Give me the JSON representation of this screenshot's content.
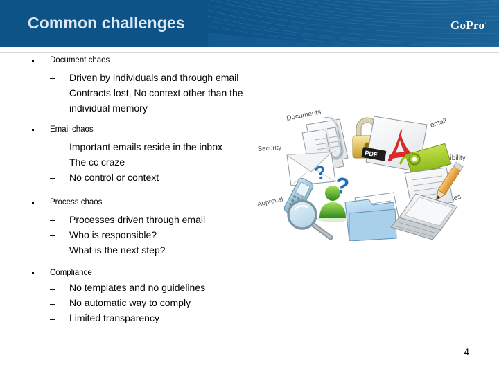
{
  "header": {
    "title": "Common challenges",
    "logo_text": "GoPro",
    "logo_mark": "·",
    "background_color": "#0e5387",
    "title_color": "#dce8f4"
  },
  "content": {
    "blocks": [
      {
        "heading": "Document chaos",
        "items": [
          "Driven by individuals and through email",
          "Contracts lost, No context other than the",
          "individual memory"
        ]
      },
      {
        "heading": "Email chaos",
        "items": [
          "Important emails reside in the inbox",
          "The cc craze",
          "No control or context"
        ]
      },
      {
        "heading": "Process chaos",
        "items": [
          "Processes driven through email",
          "Who is responsible?",
          "What is the next step?"
        ]
      },
      {
        "heading": "Compliance",
        "items": [
          "No templates and no guidelines",
          "No automatic way to comply",
          "Limited transparency"
        ]
      }
    ],
    "bullet_dash": "–"
  },
  "collage": {
    "labels": {
      "documents": "Documents",
      "security": "Security",
      "approval": "Approval",
      "email": "email",
      "responsibility": "Responsibility",
      "phases": "Phases"
    },
    "pdf_badge": "PDF",
    "question_mark": "?",
    "icon_names": [
      "paperclip-documents-icon",
      "envelope-icon",
      "padlock-icon",
      "pdf-document-icon",
      "green-tag-icon",
      "notepad-pencil-icon",
      "mobile-phone-icon",
      "magnifier-icon",
      "folder-documents-icon",
      "laptop-icon",
      "person-avatar-icon",
      "question-mark-icon"
    ]
  },
  "footer": {
    "page_number": "4"
  }
}
